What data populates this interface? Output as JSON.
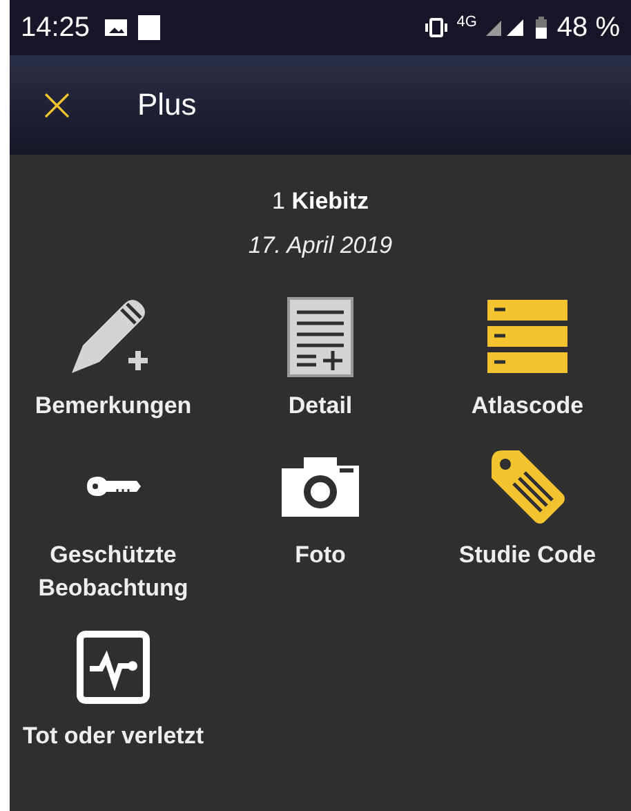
{
  "status_bar": {
    "time": "14:25",
    "network": "4G",
    "battery": "48 %"
  },
  "header": {
    "close": "×",
    "title": "Plus"
  },
  "record": {
    "count": "1",
    "species": "Kiebitz",
    "date": "17. April 2019"
  },
  "actions": [
    {
      "kind": "pencil",
      "label": "Bemerkungen"
    },
    {
      "kind": "document",
      "label": "Detail"
    },
    {
      "kind": "stack",
      "label": "Atlascode"
    },
    {
      "kind": "key",
      "label": "Geschützte Beobachtung"
    },
    {
      "kind": "camera",
      "label": "Foto"
    },
    {
      "kind": "tag",
      "label": "Studie Code"
    },
    {
      "kind": "pulse",
      "label": "Tot oder verletzt"
    }
  ]
}
